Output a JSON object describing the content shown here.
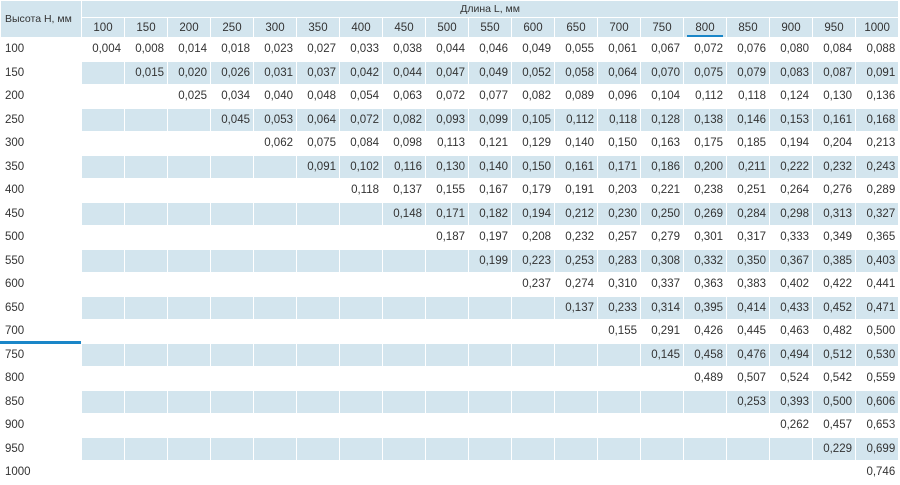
{
  "header": {
    "row_title": "Высота H, мм",
    "col_title": "Длина L, мм",
    "highlight_column": "800",
    "highlight_row": "700",
    "accent_color": "#1a86c8",
    "band_color": "#d3e5ee"
  },
  "columns": [
    "100",
    "150",
    "200",
    "250",
    "300",
    "350",
    "400",
    "450",
    "500",
    "550",
    "600",
    "650",
    "700",
    "750",
    "800",
    "850",
    "900",
    "950",
    "1000"
  ],
  "rows": [
    {
      "h": "100",
      "v": [
        "0,004",
        "0,008",
        "0,014",
        "0,018",
        "0,023",
        "0,027",
        "0,033",
        "0,038",
        "0,044",
        "0,046",
        "0,049",
        "0,055",
        "0,061",
        "0,067",
        "0,072",
        "0,076",
        "0,080",
        "0,084",
        "0,088"
      ]
    },
    {
      "h": "150",
      "v": [
        "",
        "0,015",
        "0,020",
        "0,026",
        "0,031",
        "0,037",
        "0,042",
        "0,044",
        "0,047",
        "0,049",
        "0,052",
        "0,058",
        "0,064",
        "0,070",
        "0,075",
        "0,079",
        "0,083",
        "0,087",
        "0,091"
      ]
    },
    {
      "h": "200",
      "v": [
        "",
        "",
        "0,025",
        "0,034",
        "0,040",
        "0,048",
        "0,054",
        "0,063",
        "0,072",
        "0,077",
        "0,082",
        "0,089",
        "0,096",
        "0,104",
        "0,112",
        "0,118",
        "0,124",
        "0,130",
        "0,136"
      ]
    },
    {
      "h": "250",
      "v": [
        "",
        "",
        "",
        "0,045",
        "0,053",
        "0,064",
        "0,072",
        "0,082",
        "0,093",
        "0,099",
        "0,105",
        "0,112",
        "0,118",
        "0,128",
        "0,138",
        "0,146",
        "0,153",
        "0,161",
        "0,168"
      ]
    },
    {
      "h": "300",
      "v": [
        "",
        "",
        "",
        "",
        "0,062",
        "0,075",
        "0,084",
        "0,098",
        "0,113",
        "0,121",
        "0,129",
        "0,140",
        "0,150",
        "0,163",
        "0,175",
        "0,185",
        "0,194",
        "0,204",
        "0,213"
      ]
    },
    {
      "h": "350",
      "v": [
        "",
        "",
        "",
        "",
        "",
        "0,091",
        "0,102",
        "0,116",
        "0,130",
        "0,140",
        "0,150",
        "0,161",
        "0,171",
        "0,186",
        "0,200",
        "0,211",
        "0,222",
        "0,232",
        "0,243"
      ]
    },
    {
      "h": "400",
      "v": [
        "",
        "",
        "",
        "",
        "",
        "",
        "0,118",
        "0,137",
        "0,155",
        "0,167",
        "0,179",
        "0,191",
        "0,203",
        "0,221",
        "0,238",
        "0,251",
        "0,264",
        "0,276",
        "0,289"
      ]
    },
    {
      "h": "450",
      "v": [
        "",
        "",
        "",
        "",
        "",
        "",
        "",
        "0,148",
        "0,171",
        "0,182",
        "0,194",
        "0,212",
        "0,230",
        "0,250",
        "0,269",
        "0,284",
        "0,298",
        "0,313",
        "0,327"
      ]
    },
    {
      "h": "500",
      "v": [
        "",
        "",
        "",
        "",
        "",
        "",
        "",
        "",
        "0,187",
        "0,197",
        "0,208",
        "0,232",
        "0,257",
        "0,279",
        "0,301",
        "0,317",
        "0,333",
        "0,349",
        "0,365"
      ]
    },
    {
      "h": "550",
      "v": [
        "",
        "",
        "",
        "",
        "",
        "",
        "",
        "",
        "",
        "0,199",
        "0,223",
        "0,253",
        "0,283",
        "0,308",
        "0,332",
        "0,350",
        "0,367",
        "0,385",
        "0,403"
      ]
    },
    {
      "h": "600",
      "v": [
        "",
        "",
        "",
        "",
        "",
        "",
        "",
        "",
        "",
        "",
        "0,237",
        "0,274",
        "0,310",
        "0,337",
        "0,363",
        "0,383",
        "0,402",
        "0,422",
        "0,441"
      ]
    },
    {
      "h": "650",
      "v": [
        "",
        "",
        "",
        "",
        "",
        "",
        "",
        "",
        "",
        "",
        "",
        "0,137",
        "0,233",
        "0,314",
        "0,395",
        "0,414",
        "0,433",
        "0,452",
        "0,471"
      ]
    },
    {
      "h": "700",
      "v": [
        "",
        "",
        "",
        "",
        "",
        "",
        "",
        "",
        "",
        "",
        "",
        "",
        "0,155",
        "0,291",
        "0,426",
        "0,445",
        "0,463",
        "0,482",
        "0,500"
      ]
    },
    {
      "h": "750",
      "v": [
        "",
        "",
        "",
        "",
        "",
        "",
        "",
        "",
        "",
        "",
        "",
        "",
        "",
        "0,145",
        "0,458",
        "0,476",
        "0,494",
        "0,512",
        "0,530"
      ]
    },
    {
      "h": "800",
      "v": [
        "",
        "",
        "",
        "",
        "",
        "",
        "",
        "",
        "",
        "",
        "",
        "",
        "",
        "",
        "0,489",
        "0,507",
        "0,524",
        "0,542",
        "0,559"
      ]
    },
    {
      "h": "850",
      "v": [
        "",
        "",
        "",
        "",
        "",
        "",
        "",
        "",
        "",
        "",
        "",
        "",
        "",
        "",
        "",
        "0,253",
        "0,393",
        "0,500",
        "0,606"
      ]
    },
    {
      "h": "900",
      "v": [
        "",
        "",
        "",
        "",
        "",
        "",
        "",
        "",
        "",
        "",
        "",
        "",
        "",
        "",
        "",
        "",
        "0,262",
        "0,457",
        "0,653"
      ]
    },
    {
      "h": "950",
      "v": [
        "",
        "",
        "",
        "",
        "",
        "",
        "",
        "",
        "",
        "",
        "",
        "",
        "",
        "",
        "",
        "",
        "",
        "0,229",
        "0,699"
      ]
    },
    {
      "h": "1000",
      "v": [
        "",
        "",
        "",
        "",
        "",
        "",
        "",
        "",
        "",
        "",
        "",
        "",
        "",
        "",
        "",
        "",
        "",
        "",
        "0,746"
      ]
    }
  ]
}
